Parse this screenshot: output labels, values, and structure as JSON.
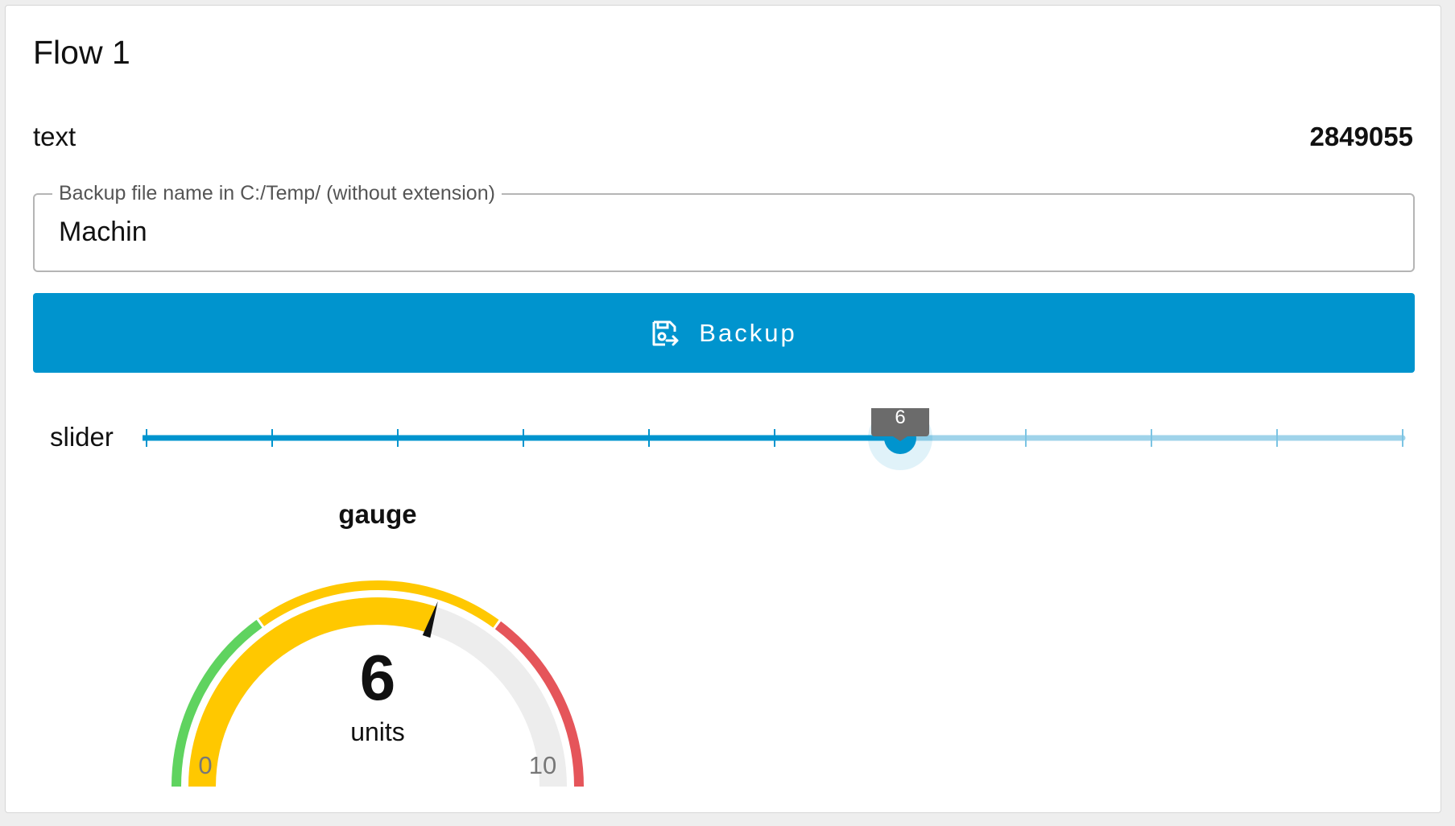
{
  "group": {
    "title": "Flow 1"
  },
  "text_widget": {
    "label": "text",
    "value": "2849055"
  },
  "backup_field": {
    "label": "Backup file name in C:/Temp/ (without extension)",
    "value": "Machin"
  },
  "backup_button": {
    "label": "Backup",
    "icon": "save-export-icon"
  },
  "slider": {
    "label": "slider",
    "min": 0,
    "max": 10,
    "value": 6,
    "tooltip": "6",
    "color": "#0094ce"
  },
  "gauge": {
    "title": "gauge",
    "value": "6",
    "units": "units",
    "min_label": "0",
    "max_label": "10",
    "min": 0,
    "max": 10,
    "level": 6,
    "segments": [
      {
        "from": 0,
        "to": 3,
        "color": "#5fd35f"
      },
      {
        "from": 3,
        "to": 7,
        "color": "#ffc800"
      },
      {
        "from": 7,
        "to": 10,
        "color": "#e5555a"
      }
    ],
    "fill_color": "#ffc800",
    "track_color": "#ededed"
  }
}
